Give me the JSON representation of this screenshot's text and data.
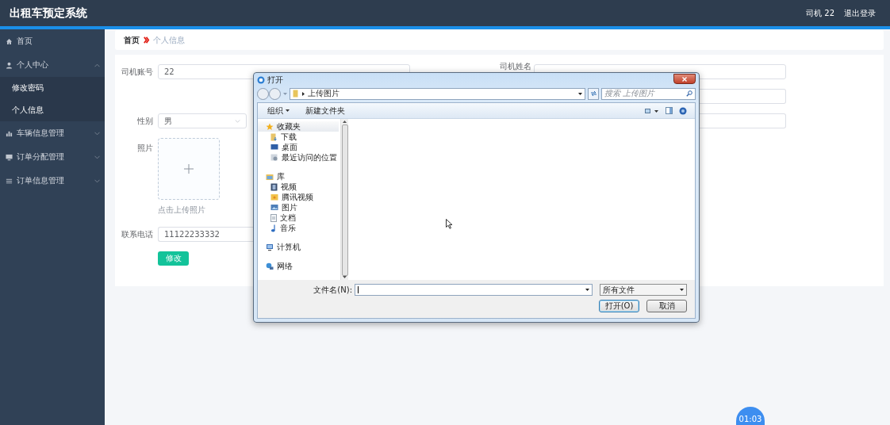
{
  "header": {
    "title": "出租车预定系统",
    "user": "司机 22",
    "logout": "退出登录"
  },
  "sidebar": {
    "items": [
      {
        "label": "首页"
      },
      {
        "label": "个人中心",
        "expanded": true,
        "children": [
          {
            "label": "修改密码"
          },
          {
            "label": "个人信息"
          }
        ]
      },
      {
        "label": "车辆信息管理",
        "expanded": false
      },
      {
        "label": "订单分配管理",
        "expanded": false
      },
      {
        "label": "订单信息管理",
        "expanded": false
      }
    ]
  },
  "breadcrumb": [
    "首页",
    "个人信息"
  ],
  "form": {
    "account": {
      "label": "司机账号",
      "value": "22"
    },
    "name": {
      "label": "司机姓名"
    },
    "gender": {
      "label": "性别",
      "value": "男"
    },
    "photo": {
      "label": "照片",
      "hint": "点击上传照片"
    },
    "phone": {
      "label": "联系电话",
      "value": "11122233332"
    },
    "submit": "修改"
  },
  "dialog": {
    "title": "打开",
    "path": "上传图片",
    "search_placeholder": "搜索 上传图片",
    "toolbar": [
      "组织",
      "新建文件夹"
    ],
    "nav": [
      {
        "label": "收藏夹",
        "selected": true,
        "children": [
          {
            "label": "下载"
          },
          {
            "label": "桌面"
          },
          {
            "label": "最近访问的位置"
          }
        ]
      },
      {
        "label": "库",
        "selected": false,
        "children": [
          {
            "label": "视频"
          },
          {
            "label": "腾讯视频"
          },
          {
            "label": "图片"
          },
          {
            "label": "文档"
          },
          {
            "label": "音乐"
          }
        ]
      },
      {
        "label": "计算机",
        "selected": false
      },
      {
        "label": "网络",
        "selected": false
      }
    ],
    "filename_label": "文件名(N):",
    "filter": "所有文件",
    "buttons": [
      "打开(O)",
      "取消"
    ]
  },
  "timer": "01:03"
}
